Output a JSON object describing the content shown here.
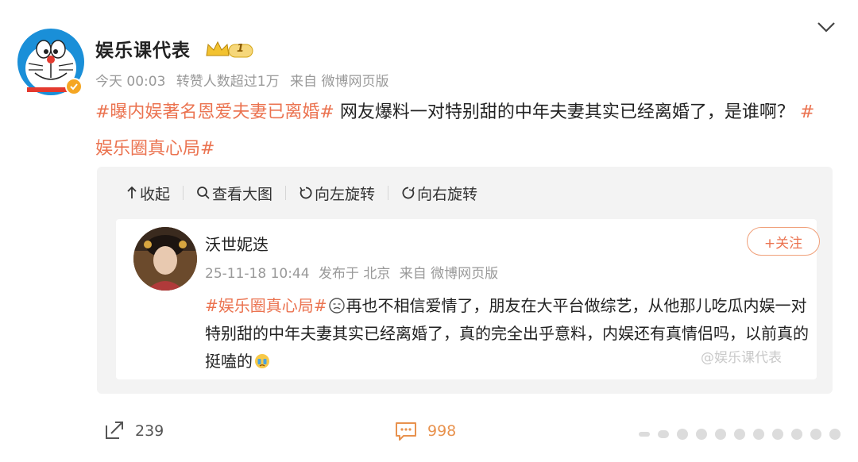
{
  "post": {
    "author": {
      "name": "娱乐课代表",
      "badge_level": "1",
      "avatar_icon": "doraemon-avatar",
      "verified_icon": "verified-badge-icon"
    },
    "meta": {
      "time": "今天 00:03",
      "reposts": "转赞人数超过1万",
      "source": "来自 微博网页版"
    },
    "text": {
      "hashtag1": "#曝内娱著名恩爱夫妻已离婚#",
      "body": " 网友爆料一对特别甜的中年夫妻其实已经离婚了，是谁啊？",
      "hashtag2": "#娱乐圈真心局#"
    }
  },
  "media_toolbar": {
    "collapse": "收起",
    "view_large": "查看大图",
    "rotate_left": "向左旋转",
    "rotate_right": "向右旋转"
  },
  "quoted": {
    "name": "沃世妮迭",
    "time": "25-11-18 10:44",
    "location": "发布于 北京",
    "source": "来自 微博网页版",
    "follow_label": "+关注",
    "hashtag": "#娱乐圈真心局#",
    "text1": "再也不相信爱情了，朋友在大平台做综艺，从他那儿吃瓜内娱一对特别甜的中年夫妻其实已经离婚了，真的完全出乎意料，内娱还有真情侣吗，以前真的挺嗑的",
    "watermark": "@娱乐课代表"
  },
  "footer": {
    "repost_count": "239",
    "comment_count": "998"
  },
  "colors": {
    "accent": "#eb7350",
    "meta_gray": "#999999",
    "panel_bg": "#f3f3f3"
  }
}
